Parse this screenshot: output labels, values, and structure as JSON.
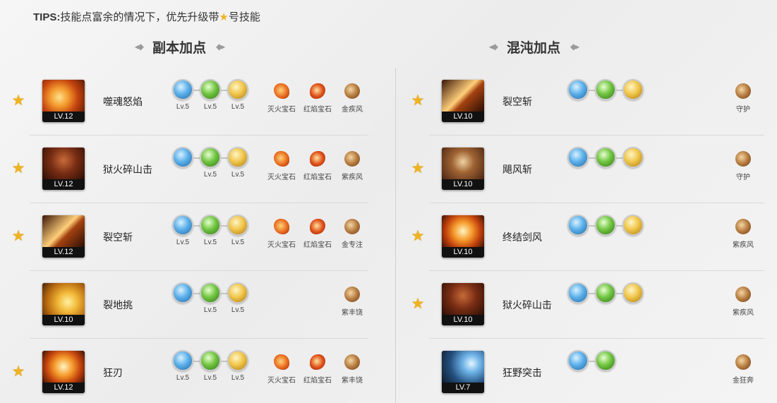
{
  "tips": {
    "key": "TIPS:",
    "text_before": "技能点富余的情况下，优先升级带",
    "text_after": "号技能"
  },
  "left": {
    "title": "副本加点",
    "rows": [
      {
        "star": true,
        "level": "LV.12",
        "name": "噬魂怒焰",
        "art": "fire",
        "runes": [
          {
            "color": "blue",
            "lv": "Lv.5"
          },
          {
            "color": "green",
            "lv": "Lv.5"
          },
          {
            "color": "gold",
            "lv": "Lv.5"
          }
        ],
        "gems": [
          {
            "kind": "fire",
            "label": "灭火宝石"
          },
          {
            "kind": "red",
            "label": "红焰宝石"
          },
          {
            "kind": "wind",
            "label": "金疾风"
          }
        ]
      },
      {
        "star": true,
        "level": "LV.12",
        "name": "狱火碎山击",
        "art": "dark",
        "runes": [
          {
            "color": "blue",
            "lv": ""
          },
          {
            "color": "green",
            "lv": "Lv.5"
          },
          {
            "color": "gold",
            "lv": "Lv.5"
          }
        ],
        "gems": [
          {
            "kind": "fire",
            "label": "灭火宝石"
          },
          {
            "kind": "red",
            "label": "红焰宝石"
          },
          {
            "kind": "wind",
            "label": "紫疾风"
          }
        ]
      },
      {
        "star": true,
        "level": "LV.12",
        "name": "裂空斩",
        "art": "slash",
        "runes": [
          {
            "color": "blue",
            "lv": "Lv.5"
          },
          {
            "color": "green",
            "lv": "Lv.5"
          },
          {
            "color": "gold",
            "lv": "Lv.5"
          }
        ],
        "gems": [
          {
            "kind": "fire",
            "label": "灭火宝石"
          },
          {
            "kind": "red",
            "label": "红焰宝石"
          },
          {
            "kind": "wind",
            "label": "金专注"
          }
        ]
      },
      {
        "star": false,
        "level": "LV.10",
        "name": "裂地挑",
        "art": "gold",
        "runes": [
          {
            "color": "blue",
            "lv": ""
          },
          {
            "color": "green",
            "lv": "Lv.5"
          },
          {
            "color": "gold",
            "lv": "Lv.5"
          }
        ],
        "gems": [
          {
            "kind": "wind",
            "label": "紫丰饶"
          }
        ]
      },
      {
        "star": true,
        "level": "LV.12",
        "name": "狂刃",
        "art": "swirl",
        "runes": [
          {
            "color": "blue",
            "lv": "Lv.5"
          },
          {
            "color": "green",
            "lv": "Lv.5"
          },
          {
            "color": "gold",
            "lv": "Lv.5"
          }
        ],
        "gems": [
          {
            "kind": "fire",
            "label": "灭火宝石"
          },
          {
            "kind": "red",
            "label": "红焰宝石"
          },
          {
            "kind": "wind",
            "label": "紫丰饶"
          }
        ]
      }
    ]
  },
  "right": {
    "title": "混沌加点",
    "rows": [
      {
        "star": true,
        "level": "LV.10",
        "name": "裂空斩",
        "art": "slash",
        "runes": [
          {
            "color": "blue"
          },
          {
            "color": "green"
          },
          {
            "color": "gold"
          }
        ],
        "gems": [
          {
            "kind": "wind",
            "label": "守护"
          }
        ]
      },
      {
        "star": true,
        "level": "LV.10",
        "name": "飓风斩",
        "art": "brown",
        "runes": [
          {
            "color": "blue"
          },
          {
            "color": "green"
          },
          {
            "color": "gold"
          }
        ],
        "gems": [
          {
            "kind": "wind",
            "label": "守护"
          }
        ]
      },
      {
        "star": true,
        "level": "LV.10",
        "name": "终结剑风",
        "art": "swirl",
        "runes": [
          {
            "color": "blue"
          },
          {
            "color": "green"
          },
          {
            "color": "gold"
          }
        ],
        "gems": [
          {
            "kind": "wind",
            "label": "紫疾风"
          }
        ]
      },
      {
        "star": true,
        "level": "LV.10",
        "name": "狱火碎山击",
        "art": "dark",
        "runes": [
          {
            "color": "blue"
          },
          {
            "color": "green"
          },
          {
            "color": "gold"
          }
        ],
        "gems": [
          {
            "kind": "wind",
            "label": "紫疾风"
          }
        ]
      },
      {
        "star": false,
        "level": "LV.7",
        "name": "狂野突击",
        "art": "blue",
        "runes": [
          {
            "color": "blue"
          },
          {
            "color": "green"
          }
        ],
        "gems": [
          {
            "kind": "wind",
            "label": "金狂奔"
          }
        ]
      }
    ]
  }
}
